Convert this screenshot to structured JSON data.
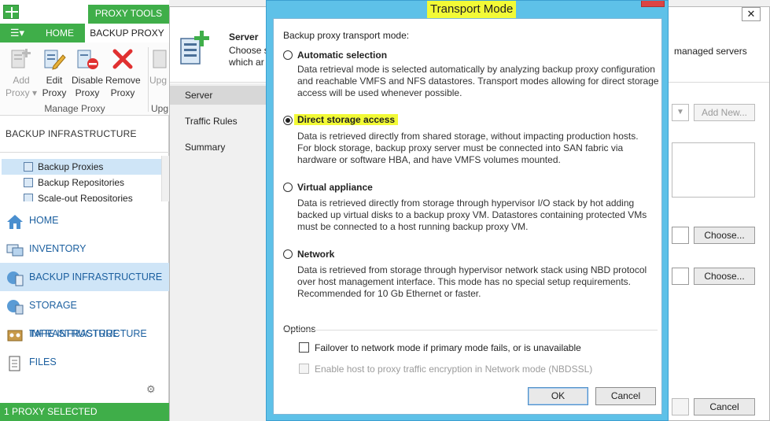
{
  "app": {
    "proxy_tools_tab": "PROXY TOOLS",
    "menu_label": "☰▾",
    "tabs": [
      {
        "label": "HOME"
      },
      {
        "label": "BACKUP PROXY"
      }
    ],
    "ribbon": {
      "buttons": [
        {
          "label1": "Add",
          "label2": "Proxy ▾",
          "icon": "add-proxy-icon"
        },
        {
          "label1": "Edit",
          "label2": "Proxy",
          "icon": "edit-proxy-icon"
        },
        {
          "label1": "Disable",
          "label2": "Proxy",
          "icon": "disable-proxy-icon"
        },
        {
          "label1": "Remove",
          "label2": "Proxy",
          "icon": "remove-proxy-icon"
        },
        {
          "label1": "Upg",
          "label2": "",
          "icon": "upgrade-icon"
        }
      ],
      "group_label": "Manage Proxy",
      "group2_label": "Upg"
    },
    "nav_section_title": "BACKUP INFRASTRUCTURE",
    "tree": [
      {
        "label": "Backup Proxies"
      },
      {
        "label": "Backup Repositories"
      },
      {
        "label": "Scale-out Repositories"
      }
    ],
    "wunderbar": [
      {
        "label": "HOME",
        "icon": "home-icon"
      },
      {
        "label": "INVENTORY",
        "icon": "inventory-icon"
      },
      {
        "label": "BACKUP INFRASTRUCTURE",
        "icon": "backup-infrastructure-icon"
      },
      {
        "label": "STORAGE INFRASTRUCTURE",
        "icon": "storage-infrastructure-icon"
      },
      {
        "label": "TAPE INFRASTRUCTURE",
        "icon": "tape-infrastructure-icon"
      },
      {
        "label": "FILES",
        "icon": "files-icon"
      }
    ],
    "status": "1 PROXY SELECTED",
    "accent_color": "#3fae49"
  },
  "wizard": {
    "close_glyph": "✕",
    "title": "Server",
    "desc_line1": "Choose s",
    "desc_line2": "which ar",
    "desc_right": "managed servers",
    "steps": [
      {
        "label": "Server"
      },
      {
        "label": "Traffic Rules"
      },
      {
        "label": "Summary"
      }
    ],
    "add_new": "Add New...",
    "choose1": "Choose...",
    "choose2": "Choose...",
    "cancel": "Cancel"
  },
  "dialog": {
    "title": "Transport Mode",
    "heading": "Backup proxy transport mode:",
    "options": [
      {
        "title": "Automatic selection",
        "lines": [
          "Data retrieval mode is selected automatically by analyzing backup proxy configuration",
          "and reachable VMFS and NFS datastores. Transport modes allowing for direct storage",
          "access will be used whenever possible."
        ],
        "selected": false
      },
      {
        "title": "Direct storage access",
        "lines": [
          "Data is retrieved directly from shared storage, without impacting production hosts.",
          "For block storage, backup proxy server must be connected into SAN fabric via",
          "hardware or software HBA, and have VMFS volumes mounted."
        ],
        "selected": true
      },
      {
        "title": "Virtual appliance",
        "lines": [
          "Data is retrieved directly from storage through hypervisor I/O stack by hot adding",
          "backed up virtual disks to a backup proxy VM. Datastores containing protected VMs",
          "must be connected to a host running backup proxy VM."
        ],
        "selected": false
      },
      {
        "title": "Network",
        "lines": [
          "Data is retrieved from storage through hypervisor network stack using NBD protocol",
          "over host management interface. This mode has no special setup requirements.",
          "Recommended for 10 Gb Ethernet or faster."
        ],
        "selected": false
      }
    ],
    "options_heading": "Options",
    "checkboxes": [
      {
        "label": "Failover to network mode if primary mode fails, or is unavailable",
        "checked": false,
        "enabled": true
      },
      {
        "label": "Enable host to proxy traffic encryption in Network mode (NBDSSL)",
        "checked": false,
        "enabled": false
      }
    ],
    "ok": "OK",
    "cancel": "Cancel",
    "highlight_color": "#f2fa36",
    "frame_color": "#5ec1e8"
  }
}
